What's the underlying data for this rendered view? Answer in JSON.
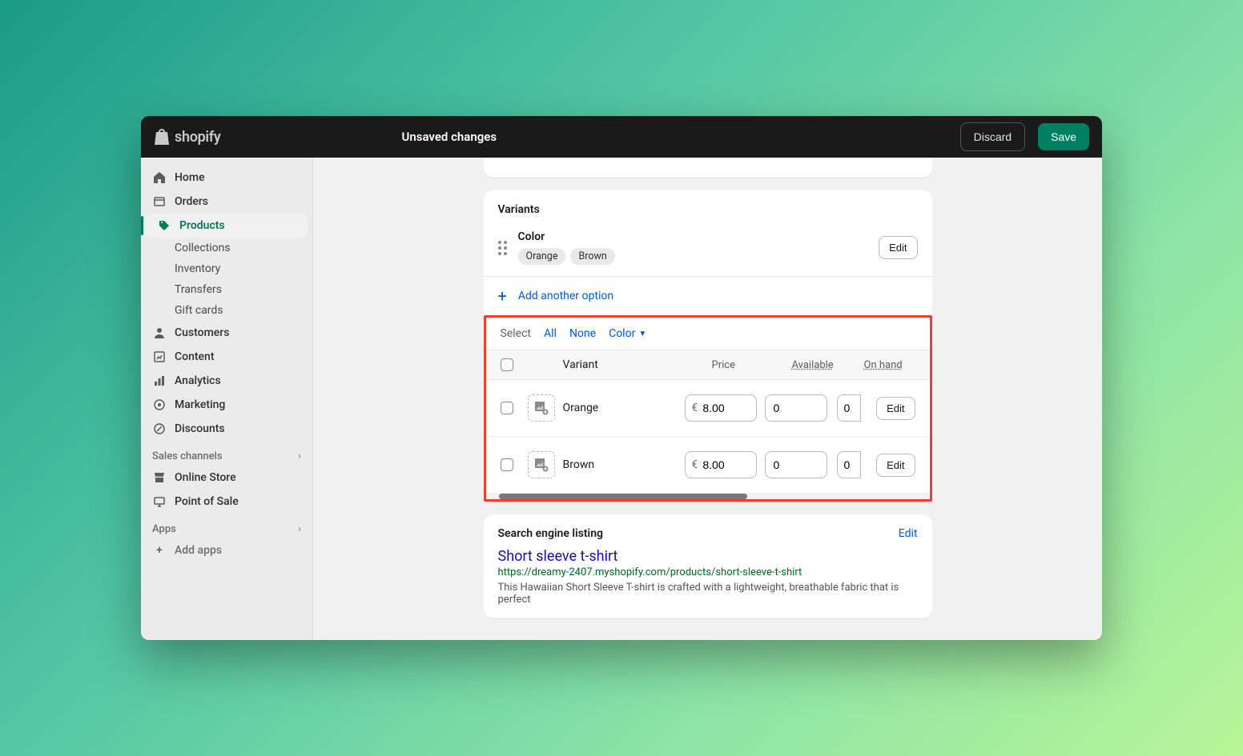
{
  "topbar": {
    "brand": "shopify",
    "title": "Unsaved changes",
    "discard": "Discard",
    "save": "Save"
  },
  "sidebar": {
    "home": "Home",
    "orders": "Orders",
    "products": "Products",
    "sub": {
      "collections": "Collections",
      "inventory": "Inventory",
      "transfers": "Transfers",
      "giftcards": "Gift cards"
    },
    "customers": "Customers",
    "content": "Content",
    "analytics": "Analytics",
    "marketing": "Marketing",
    "discounts": "Discounts",
    "sales_channels": "Sales channels",
    "online_store": "Online Store",
    "pos": "Point of Sale",
    "apps_header": "Apps",
    "add_apps": "Add apps"
  },
  "variants": {
    "heading": "Variants",
    "option_name": "Color",
    "option_values": [
      "Orange",
      "Brown"
    ],
    "edit": "Edit",
    "add_option": "Add another option",
    "select_label": "Select",
    "select_all": "All",
    "select_none": "None",
    "select_color": "Color",
    "cols": {
      "variant": "Variant",
      "price": "Price",
      "available": "Available",
      "on_hand": "On hand"
    },
    "currency": "€",
    "rows": [
      {
        "name": "Orange",
        "price": "8.00",
        "available": "0",
        "on_hand": "0"
      },
      {
        "name": "Brown",
        "price": "8.00",
        "available": "0",
        "on_hand": "0"
      }
    ],
    "row_edit": "Edit"
  },
  "seo": {
    "heading": "Search engine listing",
    "edit": "Edit",
    "title": "Short sleeve t-shirt",
    "url": "https://dreamy-2407.myshopify.com/products/short-sleeve-t-shirt",
    "desc": "This Hawaiian Short Sleeve T-shirt is crafted with a lightweight, breathable fabric that is perfect"
  }
}
